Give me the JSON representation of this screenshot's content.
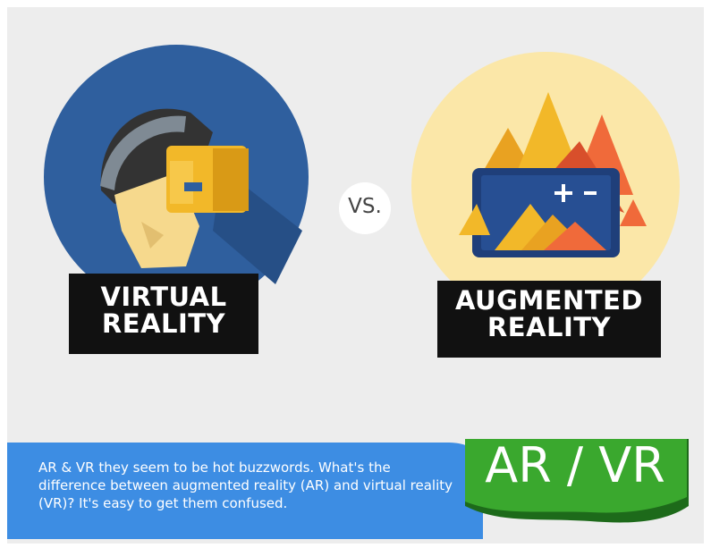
{
  "left_label": {
    "line1": "VIRTUAL",
    "line2": "REALITY"
  },
  "right_label": {
    "line1": "AUGMENTED",
    "line2": "REALITY"
  },
  "versus": "VS.",
  "description": "AR & VR they seem to be hot buzzwords. What's the difference between augmented reality (AR) and virtual reality (VR)? It's easy to get them confused.",
  "badge": "AR / VR",
  "colors": {
    "background": "#ededed",
    "vr_circle": "#2f5f9e",
    "ar_circle": "#fbe7a8",
    "headset": "#f2b829",
    "band_blue": "#3d8de3",
    "badge_green": "#3aa82e"
  },
  "icons": [
    "vr-headset-icon",
    "mountain-tablet-icon"
  ]
}
